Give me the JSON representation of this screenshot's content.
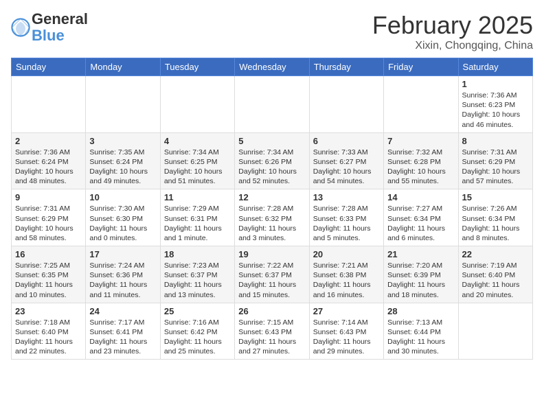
{
  "header": {
    "logo_general": "General",
    "logo_blue": "Blue",
    "month_title": "February 2025",
    "location": "Xixin, Chongqing, China"
  },
  "days_of_week": [
    "Sunday",
    "Monday",
    "Tuesday",
    "Wednesday",
    "Thursday",
    "Friday",
    "Saturday"
  ],
  "weeks": [
    [
      {
        "day": "",
        "info": ""
      },
      {
        "day": "",
        "info": ""
      },
      {
        "day": "",
        "info": ""
      },
      {
        "day": "",
        "info": ""
      },
      {
        "day": "",
        "info": ""
      },
      {
        "day": "",
        "info": ""
      },
      {
        "day": "1",
        "info": "Sunrise: 7:36 AM\nSunset: 6:23 PM\nDaylight: 10 hours and 46 minutes."
      }
    ],
    [
      {
        "day": "2",
        "info": "Sunrise: 7:36 AM\nSunset: 6:24 PM\nDaylight: 10 hours and 48 minutes."
      },
      {
        "day": "3",
        "info": "Sunrise: 7:35 AM\nSunset: 6:24 PM\nDaylight: 10 hours and 49 minutes."
      },
      {
        "day": "4",
        "info": "Sunrise: 7:34 AM\nSunset: 6:25 PM\nDaylight: 10 hours and 51 minutes."
      },
      {
        "day": "5",
        "info": "Sunrise: 7:34 AM\nSunset: 6:26 PM\nDaylight: 10 hours and 52 minutes."
      },
      {
        "day": "6",
        "info": "Sunrise: 7:33 AM\nSunset: 6:27 PM\nDaylight: 10 hours and 54 minutes."
      },
      {
        "day": "7",
        "info": "Sunrise: 7:32 AM\nSunset: 6:28 PM\nDaylight: 10 hours and 55 minutes."
      },
      {
        "day": "8",
        "info": "Sunrise: 7:31 AM\nSunset: 6:29 PM\nDaylight: 10 hours and 57 minutes."
      }
    ],
    [
      {
        "day": "9",
        "info": "Sunrise: 7:31 AM\nSunset: 6:29 PM\nDaylight: 10 hours and 58 minutes."
      },
      {
        "day": "10",
        "info": "Sunrise: 7:30 AM\nSunset: 6:30 PM\nDaylight: 11 hours and 0 minutes."
      },
      {
        "day": "11",
        "info": "Sunrise: 7:29 AM\nSunset: 6:31 PM\nDaylight: 11 hours and 1 minute."
      },
      {
        "day": "12",
        "info": "Sunrise: 7:28 AM\nSunset: 6:32 PM\nDaylight: 11 hours and 3 minutes."
      },
      {
        "day": "13",
        "info": "Sunrise: 7:28 AM\nSunset: 6:33 PM\nDaylight: 11 hours and 5 minutes."
      },
      {
        "day": "14",
        "info": "Sunrise: 7:27 AM\nSunset: 6:34 PM\nDaylight: 11 hours and 6 minutes."
      },
      {
        "day": "15",
        "info": "Sunrise: 7:26 AM\nSunset: 6:34 PM\nDaylight: 11 hours and 8 minutes."
      }
    ],
    [
      {
        "day": "16",
        "info": "Sunrise: 7:25 AM\nSunset: 6:35 PM\nDaylight: 11 hours and 10 minutes."
      },
      {
        "day": "17",
        "info": "Sunrise: 7:24 AM\nSunset: 6:36 PM\nDaylight: 11 hours and 11 minutes."
      },
      {
        "day": "18",
        "info": "Sunrise: 7:23 AM\nSunset: 6:37 PM\nDaylight: 11 hours and 13 minutes."
      },
      {
        "day": "19",
        "info": "Sunrise: 7:22 AM\nSunset: 6:37 PM\nDaylight: 11 hours and 15 minutes."
      },
      {
        "day": "20",
        "info": "Sunrise: 7:21 AM\nSunset: 6:38 PM\nDaylight: 11 hours and 16 minutes."
      },
      {
        "day": "21",
        "info": "Sunrise: 7:20 AM\nSunset: 6:39 PM\nDaylight: 11 hours and 18 minutes."
      },
      {
        "day": "22",
        "info": "Sunrise: 7:19 AM\nSunset: 6:40 PM\nDaylight: 11 hours and 20 minutes."
      }
    ],
    [
      {
        "day": "23",
        "info": "Sunrise: 7:18 AM\nSunset: 6:40 PM\nDaylight: 11 hours and 22 minutes."
      },
      {
        "day": "24",
        "info": "Sunrise: 7:17 AM\nSunset: 6:41 PM\nDaylight: 11 hours and 23 minutes."
      },
      {
        "day": "25",
        "info": "Sunrise: 7:16 AM\nSunset: 6:42 PM\nDaylight: 11 hours and 25 minutes."
      },
      {
        "day": "26",
        "info": "Sunrise: 7:15 AM\nSunset: 6:43 PM\nDaylight: 11 hours and 27 minutes."
      },
      {
        "day": "27",
        "info": "Sunrise: 7:14 AM\nSunset: 6:43 PM\nDaylight: 11 hours and 29 minutes."
      },
      {
        "day": "28",
        "info": "Sunrise: 7:13 AM\nSunset: 6:44 PM\nDaylight: 11 hours and 30 minutes."
      },
      {
        "day": "",
        "info": ""
      }
    ]
  ]
}
